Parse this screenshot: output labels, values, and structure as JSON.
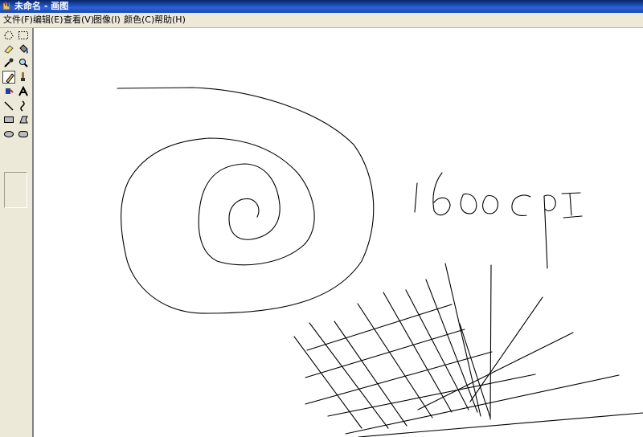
{
  "window": {
    "title": "未命名 - 画图",
    "icon": "paint-app-icon"
  },
  "menu": [
    {
      "label": "文件(F)"
    },
    {
      "label": "编辑(E)"
    },
    {
      "label": "查看(V)"
    },
    {
      "label": "图像(I)"
    },
    {
      "label": "颜色(C)"
    },
    {
      "label": "帮助(H)"
    }
  ],
  "toolbox": {
    "selected_tool": "pencil",
    "tools": [
      "free-form-select",
      "select",
      "eraser",
      "fill",
      "pick-color",
      "magnifier",
      "pencil",
      "brush",
      "airbrush",
      "text",
      "line",
      "curve",
      "rectangle",
      "polygon",
      "ellipse",
      "rounded-rectangle"
    ]
  },
  "canvas": {
    "handwritten_text": "1600CPI",
    "background": "#ffffff",
    "stroke_color": "#000000"
  }
}
